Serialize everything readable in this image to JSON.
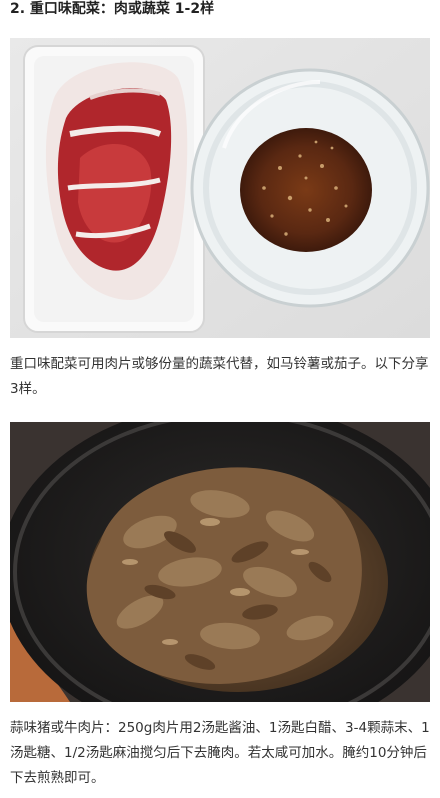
{
  "section": {
    "heading": "2. 重口味配菜：肉或蔬菜 1-2样"
  },
  "images": [
    {
      "name": "raw-meat-and-sauce-photo"
    },
    {
      "name": "fried-meat-in-pan-photo"
    }
  ],
  "paragraphs": {
    "intro": "重口味配菜可用肉片或够份量的蔬菜代替，如马铃薯或茄子。以下分享3样。",
    "recipe": "蒜味猪或牛肉片：250g肉片用2汤匙酱油、1汤匙白醋、3-4颗蒜末、1汤匙糖、1/2汤匙麻油搅匀后下去腌肉。若太咸可加水。腌约10分钟后下去煎熟即可。"
  },
  "colors": {
    "meat_red": "#b0262c",
    "sauce_brown": "#5a2812",
    "pan_dark": "#1e1d1d",
    "cooked_meat": "#8a6a4a"
  }
}
